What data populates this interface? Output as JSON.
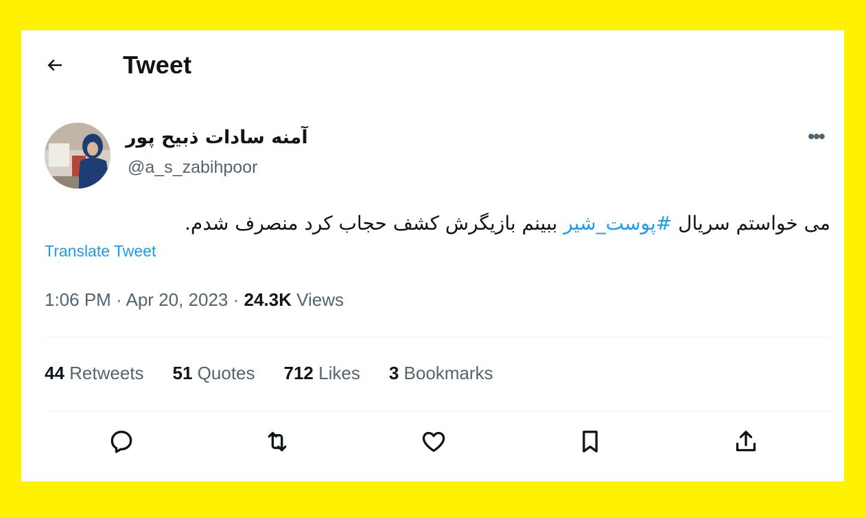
{
  "header": {
    "title": "Tweet"
  },
  "author": {
    "display_name": "آمنه سادات ذبیح پور",
    "handle": "@a_s_zabihpoor"
  },
  "tweet": {
    "text_before": "می خواستم سریال ",
    "hashtag": "#پوست_شیر",
    "text_after": " ببینم بازیگرش کشف حجاب کرد منصرف شدم.",
    "translate_label": "Translate Tweet"
  },
  "meta": {
    "time": "1:06 PM",
    "separator1": " · ",
    "date": "Apr 20, 2023",
    "separator2": " · ",
    "views_count": "24.3K",
    "views_label": " Views"
  },
  "stats": [
    {
      "count": "44",
      "label": " Retweets"
    },
    {
      "count": "51",
      "label": " Quotes"
    },
    {
      "count": "712",
      "label": " Likes"
    },
    {
      "count": "3",
      "label": " Bookmarks"
    }
  ],
  "icons": {
    "back": "arrow-left-icon",
    "more": "more-horizontal-icon",
    "reply": "reply-icon",
    "retweet": "retweet-icon",
    "like": "heart-icon",
    "bookmark": "bookmark-icon",
    "share": "share-icon"
  },
  "colors": {
    "frame": "#fff200",
    "accent": "#1d9bf0",
    "secondary_text": "#536471",
    "primary_text": "#0f1419",
    "divider": "#eff3f4"
  }
}
